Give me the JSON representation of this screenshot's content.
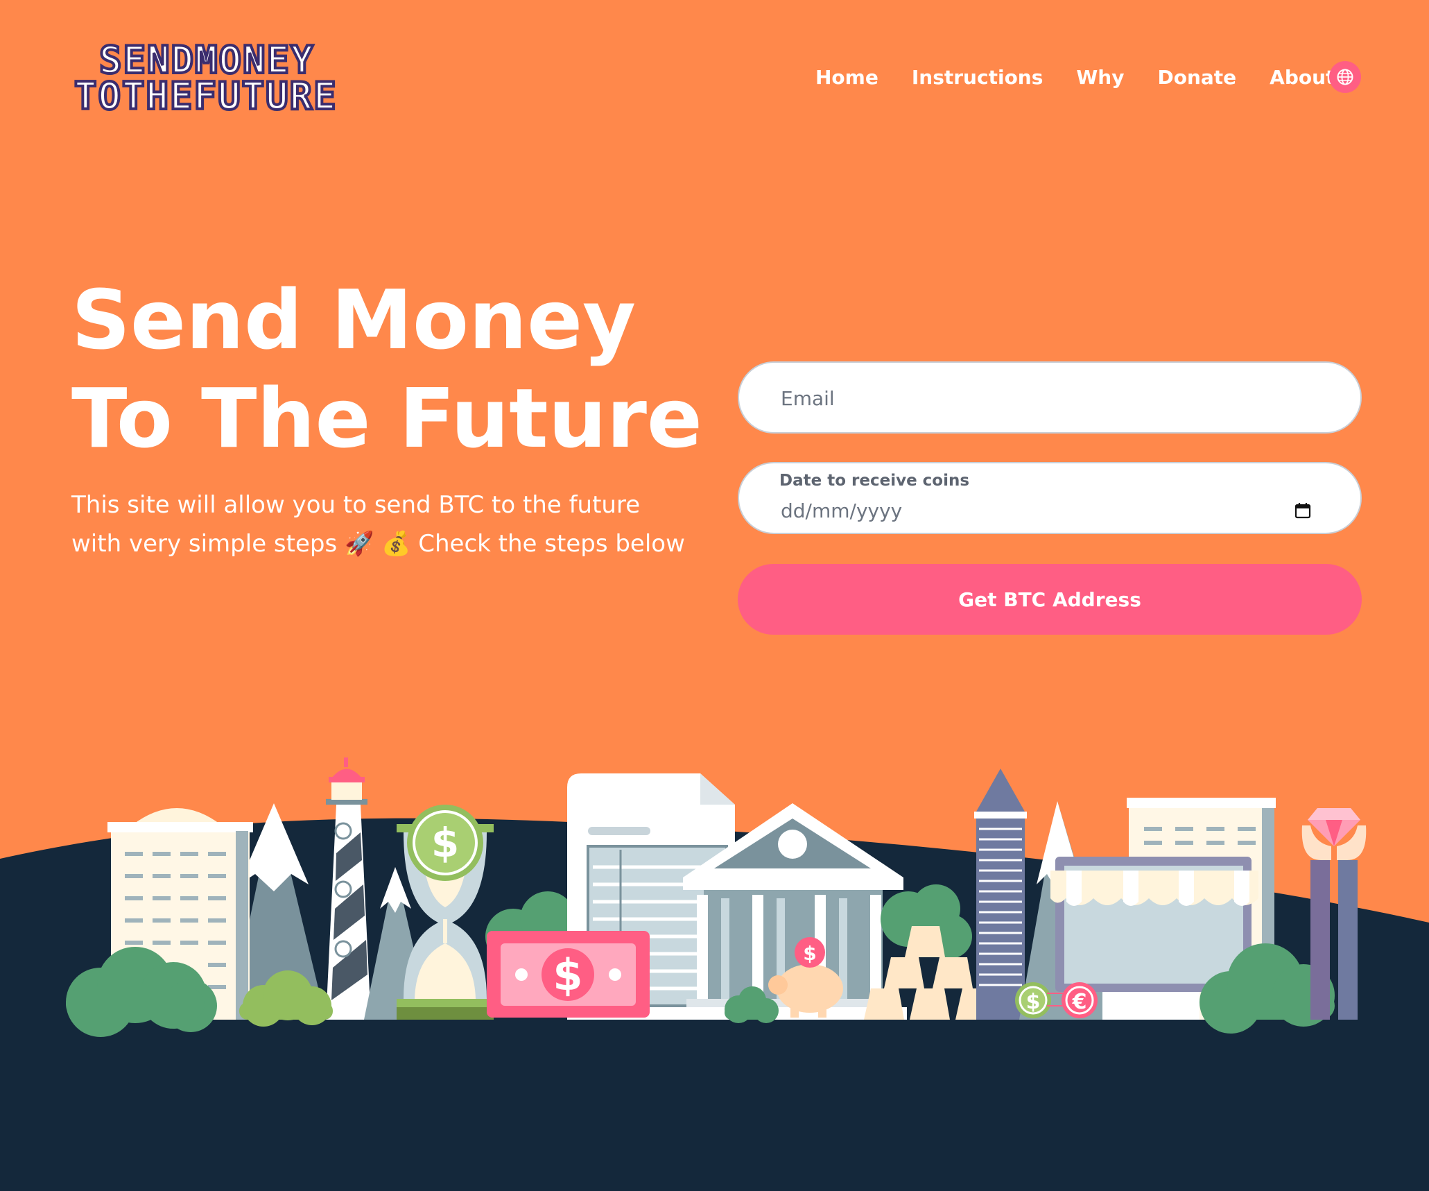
{
  "header": {
    "logo_line1": "SENDMONEY",
    "logo_line2": "TOTHEFUTURE",
    "nav": {
      "home": "Home",
      "instructions": "Instructions",
      "why": "Why",
      "donate": "Donate",
      "about": "About"
    },
    "language_icon": "globe-icon"
  },
  "hero": {
    "title_line1": "Send Money",
    "title_line2": "To The Future",
    "description": "This site will allow you to send BTC to the future with very simple steps 🚀 💰 Check the steps below"
  },
  "form": {
    "email_placeholder": "Email",
    "date_label": "Date to receive coins",
    "date_placeholder": "dd/mm/yyyy",
    "calendar_icon": "calendar-icon",
    "submit_label": "Get BTC Address"
  },
  "illustration": {
    "bill_symbol": "$",
    "coin_symbol_1": "$",
    "coin_symbol_2": "$",
    "coin_symbol_3": "$",
    "euro_symbol": "€"
  },
  "colors": {
    "background": "#ff884b",
    "accent": "#ff5e84",
    "dark_ground": "#14283b",
    "text_light": "#ffffff"
  }
}
